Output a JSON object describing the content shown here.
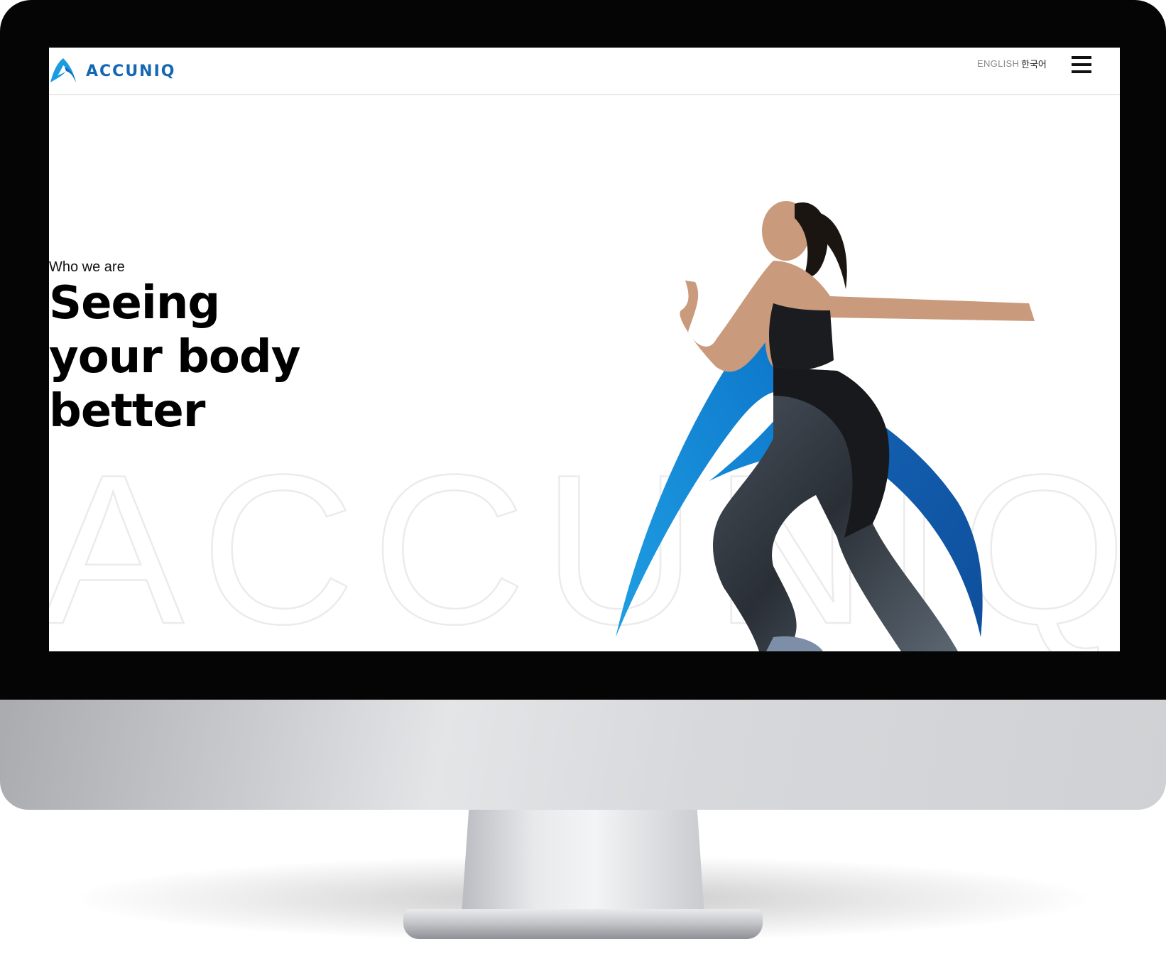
{
  "brand": {
    "name": "ACCUNIQ",
    "color": "#1468b3",
    "accent_light": "#1a9ce0"
  },
  "header": {
    "lang_english": "ENGLISH",
    "lang_korean": "한국어",
    "menu_icon": "hamburger-icon"
  },
  "hero": {
    "eyebrow": "Who we are",
    "headline_lines": [
      "Seeing",
      "your body",
      "better"
    ],
    "watermark": "ACCUNIQ",
    "image": "runner-woman-with-logo-swoosh"
  }
}
